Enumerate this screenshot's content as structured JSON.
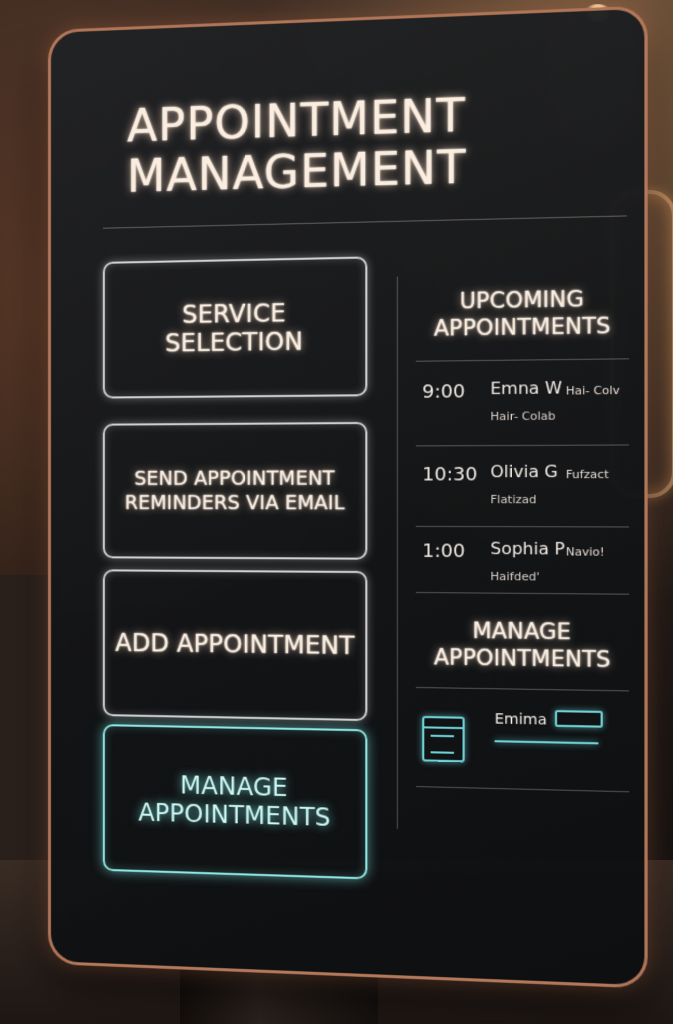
{
  "title": "Appointment Management",
  "colors": {
    "accent": "#8fe6e2",
    "frame": "#e6966e",
    "text": "#fbeee0",
    "panel": "#141618"
  },
  "buttons": {
    "service_selection": "Service Selection",
    "send_reminders": "Send Appointment Reminders via Email",
    "add_appointment": "Add Appointment",
    "manage_appointments": "Manage Appointments"
  },
  "upcoming": {
    "title": "Upcoming Appointments",
    "items": [
      {
        "time": "9:00",
        "name": "Emna W",
        "service": "Hai- Colv",
        "sub": "Hair- Colab"
      },
      {
        "time": "10:30",
        "name": "Olivia G",
        "service": "Fufzact",
        "sub": "Flatizad"
      },
      {
        "time": "1:00",
        "name": "Sophia P",
        "service": "Navio!",
        "sub": "Haifded'"
      }
    ]
  },
  "manage_panel": {
    "title": "Manage Appointments",
    "client_name": "Emima",
    "icon": "calendar-icon"
  }
}
